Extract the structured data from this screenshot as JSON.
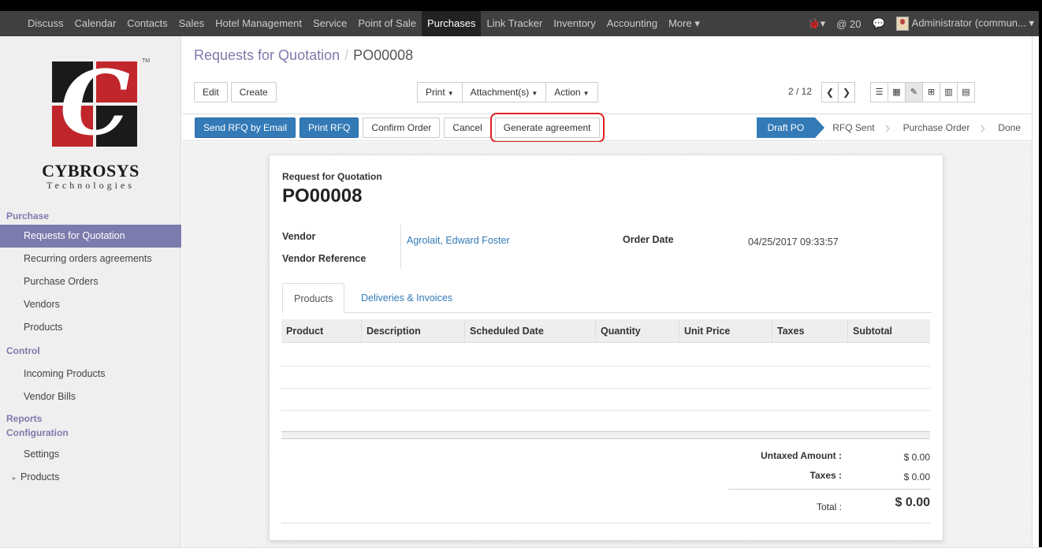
{
  "topbar": {
    "menu": [
      "Discuss",
      "Calendar",
      "Contacts",
      "Sales",
      "Hotel Management",
      "Service",
      "Point of Sale",
      "Purchases",
      "Link Tracker",
      "Inventory",
      "Accounting",
      "More ▾"
    ],
    "active_index": 7,
    "notif_count": "@ 20",
    "user": "Administrator (commun..."
  },
  "sidebar": {
    "brand": "CYBROSYS",
    "brand_sub": "Technologies",
    "tm": "TM",
    "sections": [
      {
        "title": "Purchase",
        "items": [
          "Requests for Quotation",
          "Recurring orders agreements",
          "Purchase Orders",
          "Vendors",
          "Products"
        ]
      },
      {
        "title": "Control",
        "items": [
          "Incoming Products",
          "Vendor Bills"
        ]
      },
      {
        "title": "Reports",
        "items": []
      },
      {
        "title": "Configuration",
        "items": [
          "Settings",
          "Products"
        ]
      }
    ]
  },
  "breadcrumb": {
    "parent": "Requests for Quotation",
    "sep": "/",
    "current": "PO00008"
  },
  "toolbar": {
    "edit": "Edit",
    "create": "Create",
    "print": "Print",
    "attachments": "Attachment(s)",
    "action": "Action",
    "pager": "2 / 12"
  },
  "actions": {
    "send_rfq": "Send RFQ by Email",
    "print_rfq": "Print RFQ",
    "confirm": "Confirm Order",
    "cancel": "Cancel",
    "generate": "Generate agreement"
  },
  "statusbar": [
    "Draft PO",
    "RFQ Sent",
    "Purchase Order",
    "Done"
  ],
  "form": {
    "doc_type": "Request for Quotation",
    "doc_name": "PO00008",
    "vendor_label": "Vendor",
    "vendor_value": "Agrolait, Edward Foster",
    "vendor_ref_label": "Vendor Reference",
    "order_date_label": "Order Date",
    "order_date_value": "04/25/2017 09:33:57",
    "tabs": [
      "Products",
      "Deliveries & Invoices"
    ],
    "columns": [
      "Product",
      "Description",
      "Scheduled Date",
      "Quantity",
      "Unit Price",
      "Taxes",
      "Subtotal"
    ],
    "totals": {
      "untaxed_label": "Untaxed Amount :",
      "untaxed_value": "$ 0.00",
      "taxes_label": "Taxes :",
      "taxes_value": "$ 0.00",
      "total_label": "Total :",
      "total_value": "$ 0.00"
    }
  },
  "colors": {
    "topbar": "#404040",
    "accent": "#7c7bad",
    "primary": "#337ab7",
    "highlight": "#e02020"
  }
}
